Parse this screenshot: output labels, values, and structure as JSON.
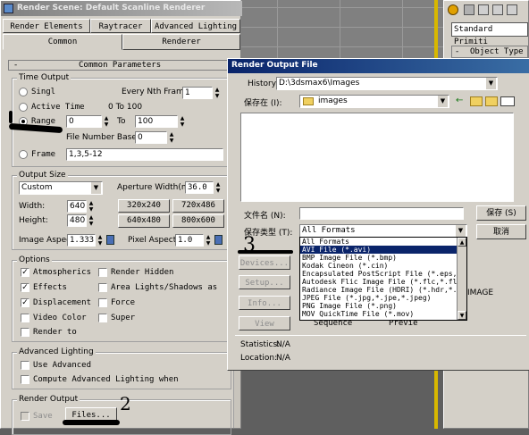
{
  "render_scene": {
    "title": "Render Scene: Default Scanline Renderer",
    "tabs_row1": [
      "Render Elements",
      "Raytracer",
      "Advanced Lighting"
    ],
    "tabs_row2": [
      "Common",
      "Renderer"
    ],
    "rollout_sign": "-",
    "rollout_title": "Common Parameters",
    "time_output": {
      "title": "Time Output",
      "single": "Singl",
      "every_nth_label": "Every Nth Frame:",
      "every_nth_value": "1",
      "active_time": "Active Time",
      "active_range": "0 To 100",
      "range": "Range",
      "range_from": "0",
      "range_to_label": "To",
      "range_to": "100",
      "file_number_base_label": "File Number Base:",
      "file_number_base": "0",
      "frame": "Frame",
      "frame_value": "1,3,5-12"
    },
    "output_size": {
      "title": "Output Size",
      "preset": "Custom",
      "aperture_label": "Aperture Width(mm):",
      "aperture_value": "36.0",
      "width_label": "Width:",
      "width_value": "640",
      "height_label": "Height:",
      "height_value": "480",
      "presets": [
        "320x240",
        "720x486",
        "640x480",
        "800x600"
      ],
      "image_aspect_label": "Image Aspect:",
      "image_aspect_value": "1.333",
      "pixel_aspect_label": "Pixel Aspect:",
      "pixel_aspect_value": "1.0"
    },
    "options": {
      "title": "Options",
      "atmospherics": "Atmospherics",
      "render_hidden": "Render Hidden",
      "effects": "Effects",
      "area_lights": "Area Lights/Shadows as",
      "displacement": "Displacement",
      "force": "Force",
      "video_color": "Video Color",
      "super": "Super",
      "render_to": "Render to"
    },
    "advanced_lighting": {
      "title": "Advanced Lighting",
      "use_advanced": "Use Advanced",
      "compute": "Compute Advanced Lighting when"
    },
    "render_output": {
      "title": "Render Output",
      "save": "Save",
      "files": "Files..."
    }
  },
  "dialog": {
    "title": "Render Output File",
    "history_label": "History:",
    "history_value": "D:\\3dsmax6\\Images",
    "save_in_label": "保存在 (I):",
    "save_in_value": "images",
    "filename_label": "文件名 (N):",
    "filename_value": "",
    "filetype_label": "保存类型 (T):",
    "filetype_value": "All Formats",
    "save_button": "保存 (S)",
    "cancel_button": "取消",
    "devices_button": "Devices...",
    "setup_button": "Setup...",
    "info_button": "Info...",
    "view_button": "View",
    "sequence": "Sequence",
    "preview": "Previe",
    "image_text": "IMAGE",
    "statistics_label": "Statistics:",
    "statistics_value": "N/A",
    "location_label": "Location:",
    "location_value": "N/A",
    "dropdown_options": [
      "All Formats",
      "AVI File (*.avi)",
      "BMP Image File (*.bmp)",
      "Kodak Cineon (*.cin)",
      "Encapsulated PostScript File (*.eps,*",
      "Autodesk Flic Image File (*.flc,*.fli",
      "Radiance Image File (HDRI) (*.hdr,*.p",
      "JPEG File (*.jpg,*.jpe,*.jpeg)",
      "PNG Image File (*.png)",
      "MOV QuickTime File (*.mov)"
    ],
    "selected_option_index": 1
  },
  "right_panel": {
    "standard_primitives": "Standard Primiti",
    "object_type_sign": "-",
    "object_type": "Object Type"
  },
  "annotations": {
    "note_2": "2",
    "note_3": "3"
  },
  "colors": {
    "title_active": "#0a246a",
    "title_inactive": "#808080",
    "face": "#d4d0c8",
    "selection": "#0a246a"
  }
}
